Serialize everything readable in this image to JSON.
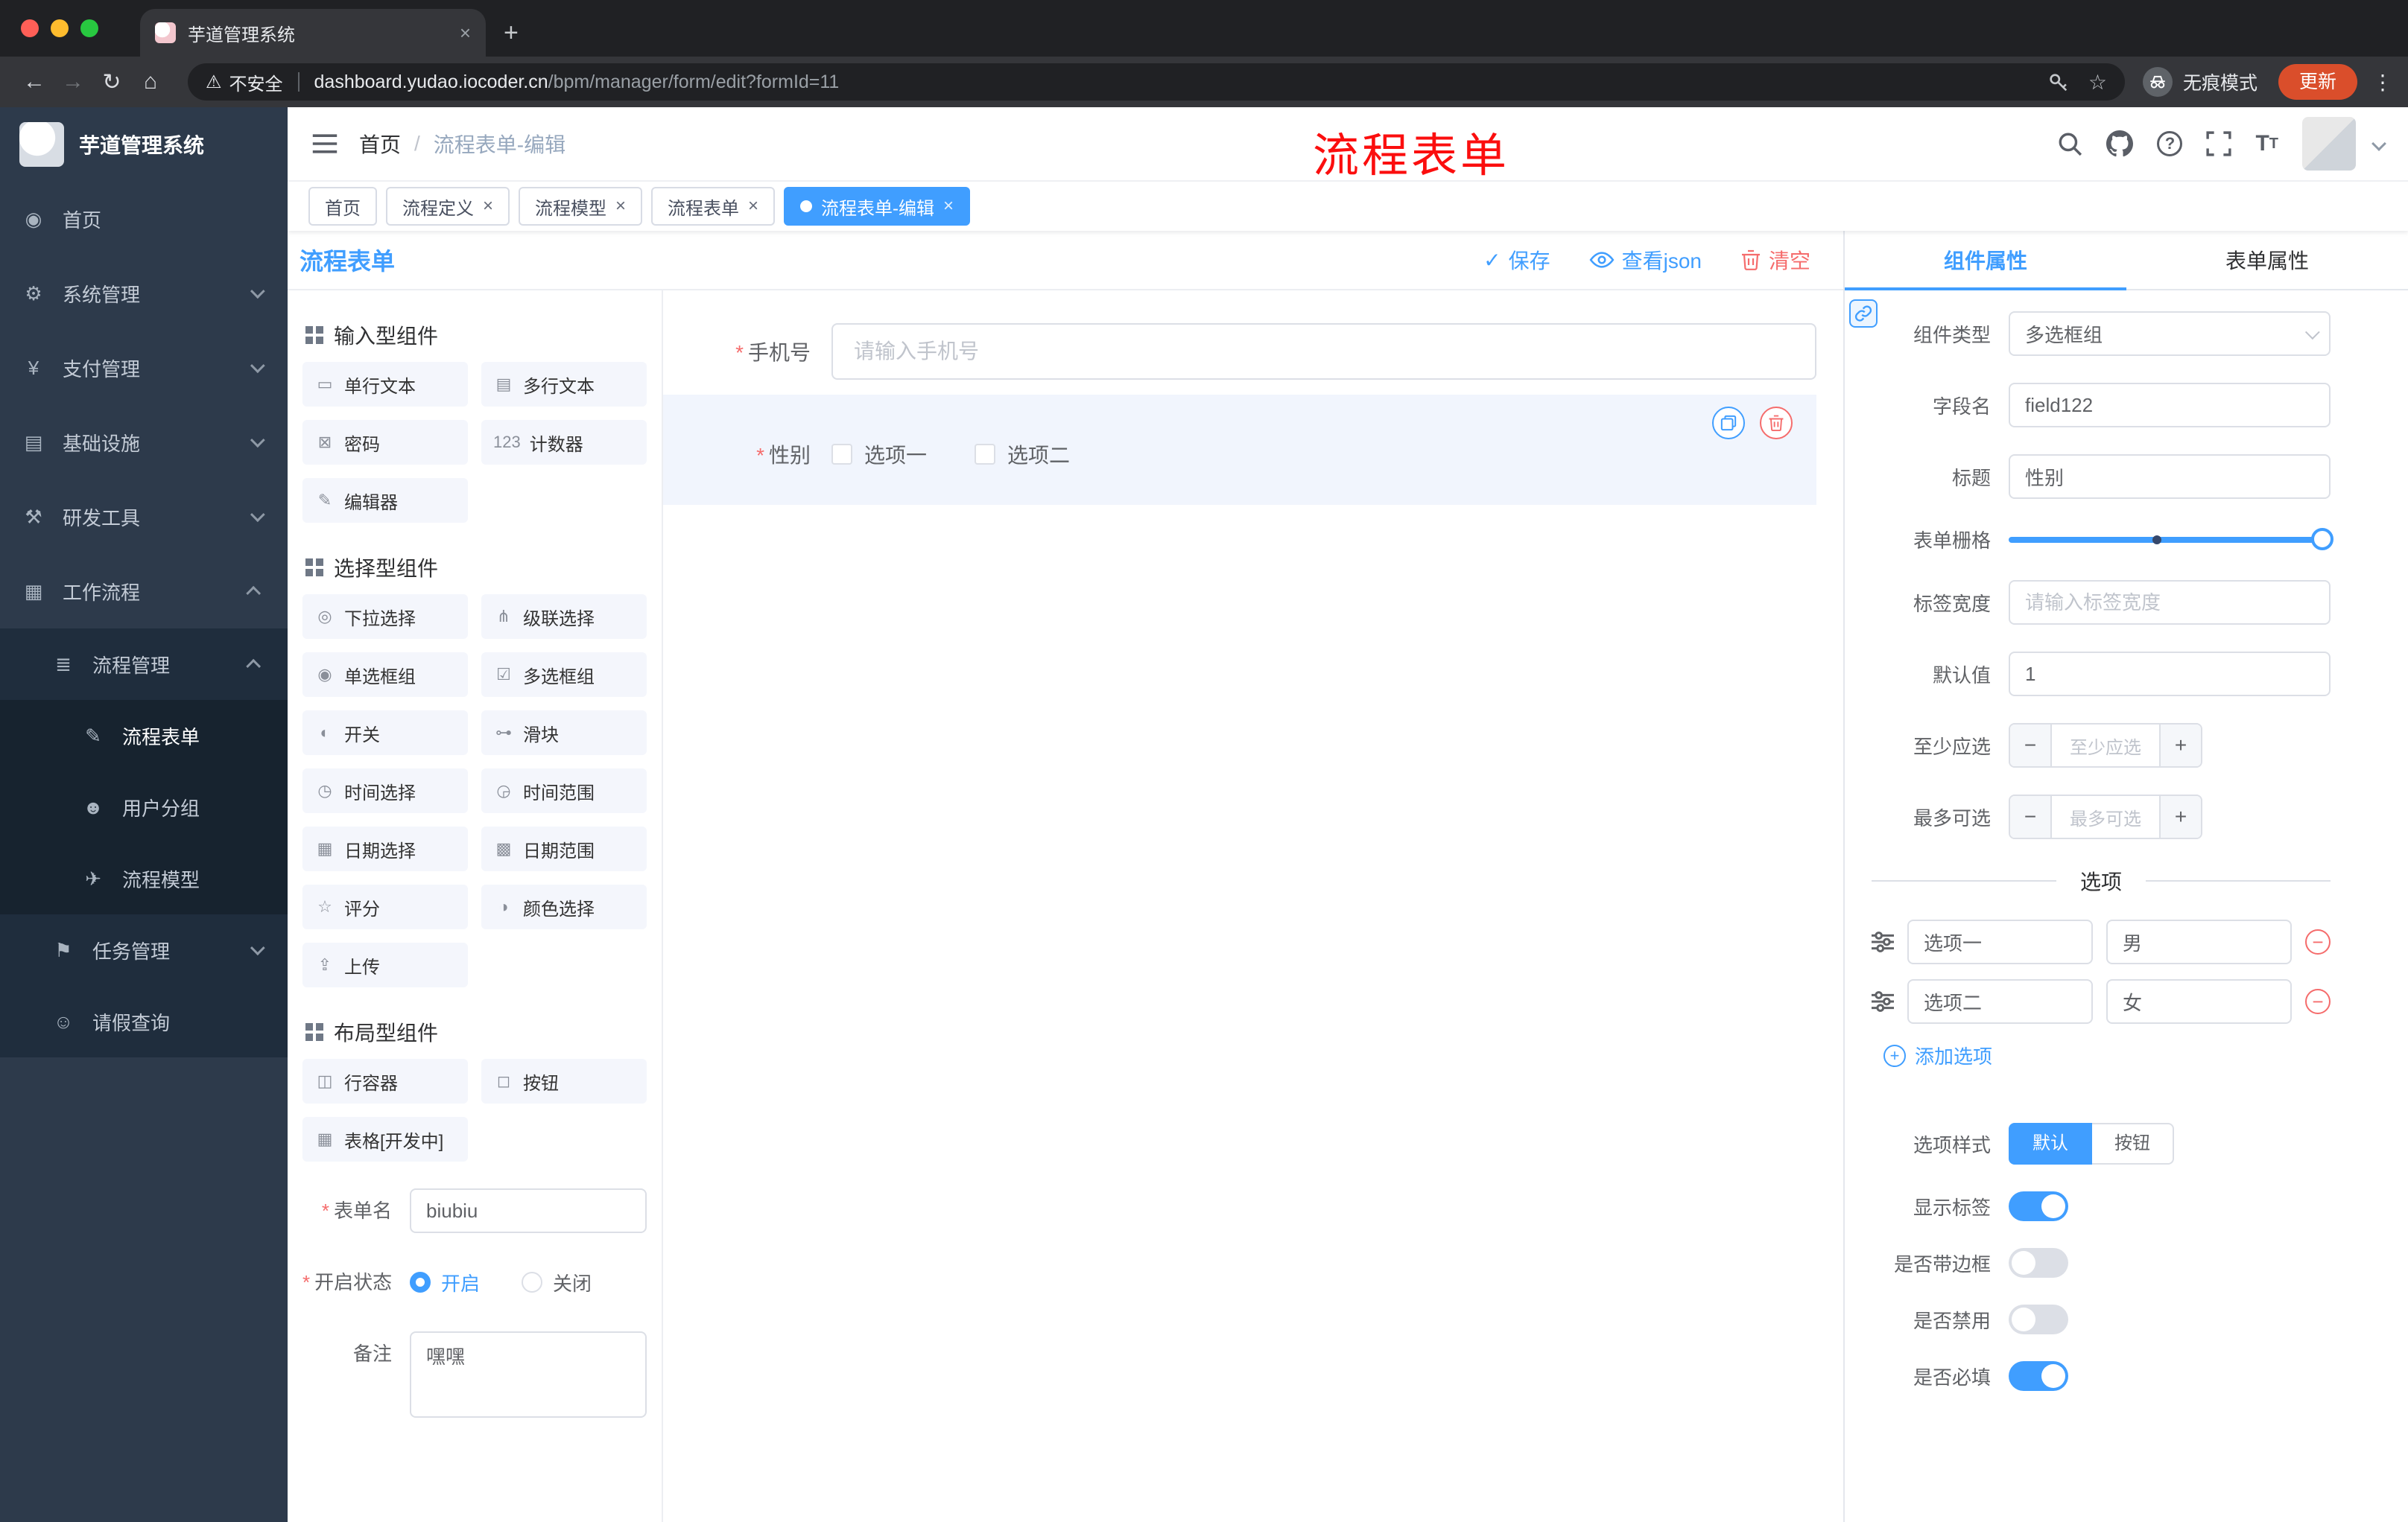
{
  "misc": {
    "star": "*",
    "slash": "/",
    "close": "×",
    "plus": "+",
    "minus": "−",
    "check": "✓",
    "ellipsis": "⋮",
    "back": "←",
    "forward": "→",
    "reload": "↻",
    "home": "⌂",
    "warning": "⚠",
    "star_outline": "☆",
    "question": "?",
    "font_big": "T",
    "font_small": "T"
  },
  "colors": {
    "accent": "#409eff",
    "danger": "#f56c6c",
    "annotation": "#fb0e0e",
    "sidebar_bg": "#2d3a4b",
    "update_button_bg": "#da4e2b"
  },
  "browser": {
    "tab_title": "芋道管理系统",
    "security": "不安全",
    "url_host": "dashboard.yudao.iocoder.cn",
    "url_path": "/bpm/manager/form/edit?formId=11",
    "incognito": "无痕模式",
    "update": "更新"
  },
  "sidebar": {
    "title": "芋道管理系统",
    "items": [
      {
        "id": "home",
        "label": "首页",
        "glyph": "◉",
        "icon": "dashboard-icon",
        "level": 1
      },
      {
        "id": "system",
        "label": "系统管理",
        "glyph": "⚙",
        "icon": "gear-icon",
        "level": 1,
        "chevron": "down"
      },
      {
        "id": "payment",
        "label": "支付管理",
        "glyph": "¥",
        "icon": "yen-icon",
        "level": 1,
        "chevron": "down"
      },
      {
        "id": "infrastructure",
        "label": "基础设施",
        "glyph": "▤",
        "icon": "infra-icon",
        "level": 1,
        "chevron": "down"
      },
      {
        "id": "devtools",
        "label": "研发工具",
        "glyph": "⚒",
        "icon": "tools-icon",
        "level": 1,
        "chevron": "down"
      },
      {
        "id": "workflow",
        "label": "工作流程",
        "glyph": "▦",
        "icon": "workflow-icon",
        "level": 1,
        "chevron": "up"
      },
      {
        "id": "process-management",
        "label": "流程管理",
        "glyph": "≣",
        "icon": "list-icon",
        "level": 2,
        "chevron": "up"
      },
      {
        "id": "process-form",
        "label": "流程表单",
        "glyph": "✎",
        "icon": "form-icon",
        "level": 3,
        "active": true
      },
      {
        "id": "user-group",
        "label": "用户分组",
        "glyph": "☻",
        "icon": "users-icon",
        "level": 3
      },
      {
        "id": "process-model",
        "label": "流程模型",
        "glyph": "✈",
        "icon": "send-icon",
        "level": 3
      },
      {
        "id": "task-management",
        "label": "任务管理",
        "glyph": "⚑",
        "icon": "tasks-icon",
        "level": 2,
        "chevron": "down"
      },
      {
        "id": "leave-query",
        "label": "请假查询",
        "glyph": "☺",
        "icon": "person-icon",
        "level": 2
      }
    ]
  },
  "header": {
    "breadcrumb_home": "首页",
    "breadcrumb_current": "流程表单-编辑",
    "annotation": "流程表单"
  },
  "tags": [
    {
      "id": "home",
      "label": "首页"
    },
    {
      "id": "process-definition",
      "label": "流程定义",
      "closable": true
    },
    {
      "id": "process-model",
      "label": "流程模型",
      "closable": true
    },
    {
      "id": "process-form",
      "label": "流程表单",
      "closable": true
    },
    {
      "id": "process-form-edit",
      "label": "流程表单-编辑",
      "closable": true,
      "active": true
    }
  ],
  "designer": {
    "title": "流程表单",
    "save": "保存",
    "view_json": "查看json",
    "clear": "清空"
  },
  "palette": {
    "groups": [
      {
        "id": "input",
        "title": "输入型组件",
        "items": [
          {
            "id": "single-line-text",
            "label": "单行文本",
            "glyph": "▭",
            "icon": "input-icon"
          },
          {
            "id": "multi-line-text",
            "label": "多行文本",
            "glyph": "▤",
            "icon": "textarea-icon"
          },
          {
            "id": "password",
            "label": "密码",
            "glyph": "⊠",
            "icon": "lock-icon"
          },
          {
            "id": "counter",
            "label": "计数器",
            "glyph": "123",
            "icon": "counter-icon"
          },
          {
            "id": "editor",
            "label": "编辑器",
            "glyph": "✎",
            "icon": "editor-icon"
          }
        ]
      },
      {
        "id": "select",
        "title": "选择型组件",
        "items": [
          {
            "id": "dropdown",
            "label": "下拉选择",
            "glyph": "◎",
            "icon": "select-icon"
          },
          {
            "id": "cascader",
            "label": "级联选择",
            "glyph": "⋔",
            "icon": "cascader-icon"
          },
          {
            "id": "radio-group",
            "label": "单选框组",
            "glyph": "◉",
            "icon": "radio-icon"
          },
          {
            "id": "checkbox-group",
            "label": "多选框组",
            "glyph": "☑",
            "icon": "checkbox-icon"
          },
          {
            "id": "switch",
            "label": "开关",
            "glyph": "◐",
            "icon": "switch-icon"
          },
          {
            "id": "slider",
            "label": "滑块",
            "glyph": "⊶",
            "icon": "slider-icon"
          },
          {
            "id": "time-picker",
            "label": "时间选择",
            "glyph": "◷",
            "icon": "time-icon"
          },
          {
            "id": "time-range",
            "label": "时间范围",
            "glyph": "◶",
            "icon": "time-range-icon"
          },
          {
            "id": "date-picker",
            "label": "日期选择",
            "glyph": "▦",
            "icon": "date-icon"
          },
          {
            "id": "date-range",
            "label": "日期范围",
            "glyph": "▩",
            "icon": "date-range-icon"
          },
          {
            "id": "rate",
            "label": "评分",
            "glyph": "☆",
            "icon": "star-icon"
          },
          {
            "id": "color-picker",
            "label": "颜色选择",
            "glyph": "◑",
            "icon": "color-icon"
          },
          {
            "id": "upload",
            "label": "上传",
            "glyph": "⇪",
            "icon": "upload-icon"
          }
        ]
      },
      {
        "id": "layout",
        "title": "布局型组件",
        "items": [
          {
            "id": "row-container",
            "label": "行容器",
            "glyph": "◫",
            "icon": "row-icon"
          },
          {
            "id": "button",
            "label": "按钮",
            "glyph": "◻",
            "icon": "button-icon"
          },
          {
            "id": "table",
            "label": "表格[开发中]",
            "glyph": "▦",
            "icon": "table-icon"
          }
        ]
      }
    ]
  },
  "form_meta": {
    "name_label": "表单名",
    "name_value": "biubiu",
    "status_label": "开启状态",
    "status_on": "开启",
    "status_off": "关闭",
    "remark_label": "备注",
    "remark_value": "嘿嘿"
  },
  "canvas": {
    "phone_label": "手机号",
    "phone_placeholder": "请输入手机号",
    "gender_label": "性别",
    "gender_options": [
      "选项一",
      "选项二"
    ]
  },
  "props": {
    "tab_component": "组件属性",
    "tab_form": "表单属性",
    "component_type_label": "组件类型",
    "component_type_value": "多选框组",
    "field_label": "字段名",
    "field_value": "field122",
    "title_label": "标题",
    "title_value": "性别",
    "grid_label": "表单栅格",
    "label_width_label": "标签宽度",
    "label_width_placeholder": "请输入标签宽度",
    "default_label": "默认值",
    "default_value": "1",
    "min_label": "至少应选",
    "min_placeholder": "至少应选",
    "max_label": "最多可选",
    "max_placeholder": "最多可选",
    "options_title": "选项",
    "options": [
      {
        "label": "选项一",
        "value": "男"
      },
      {
        "label": "选项二",
        "value": "女"
      }
    ],
    "add_option": "添加选项",
    "style_label": "选项样式",
    "style_default": "默认",
    "style_button": "按钮",
    "switches": [
      {
        "id": "show-label",
        "label": "显示标签",
        "on": true
      },
      {
        "id": "bordered",
        "label": "是否带边框",
        "on": false
      },
      {
        "id": "disabled",
        "label": "是否禁用",
        "on": false
      },
      {
        "id": "required",
        "label": "是否必填",
        "on": true
      }
    ]
  }
}
